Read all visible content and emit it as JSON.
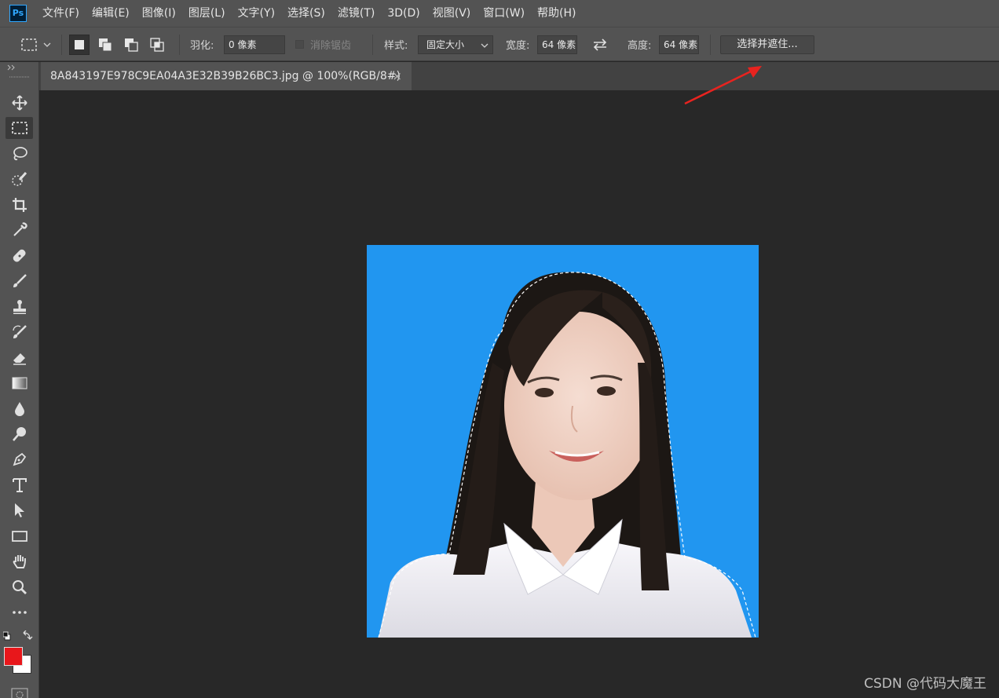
{
  "app": {
    "logo_text": "Ps"
  },
  "menu": [
    "文件(F)",
    "编辑(E)",
    "图像(I)",
    "图层(L)",
    "文字(Y)",
    "选择(S)",
    "滤镜(T)",
    "3D(D)",
    "视图(V)",
    "窗口(W)",
    "帮助(H)"
  ],
  "options": {
    "feather_label": "羽化:",
    "feather_value": "0 像素",
    "antialias_label": "消除锯齿",
    "style_label": "样式:",
    "style_value": "固定大小",
    "width_label": "宽度:",
    "width_value": "64 像素",
    "height_label": "高度:",
    "height_value": "64 像素",
    "select_mask_button": "选择并遮住..."
  },
  "document": {
    "tab_title": "8A843197E978C9EA04A3E32B39B26BC3.jpg @ 100%(RGB/8#)",
    "close_glyph": "×"
  },
  "tools": [
    "move-tool-icon",
    "rectangular-marquee-tool-icon",
    "lasso-tool-icon",
    "quick-selection-tool-icon",
    "crop-tool-icon",
    "eyedropper-tool-icon",
    "healing-brush-tool-icon",
    "brush-tool-icon",
    "clone-stamp-tool-icon",
    "history-brush-tool-icon",
    "eraser-tool-icon",
    "gradient-tool-icon",
    "blur-tool-icon",
    "dodge-tool-icon",
    "pen-tool-icon",
    "type-tool-icon",
    "path-selection-tool-icon",
    "rectangle-tool-icon",
    "hand-tool-icon",
    "zoom-tool-icon",
    "more-tools-icon"
  ],
  "colors": {
    "foreground": "#e8171b",
    "background": "#ffffff",
    "photo_background": "#2196f0",
    "annotation_arrow": "#e8231f"
  },
  "watermark": "CSDN @代码大魔王"
}
